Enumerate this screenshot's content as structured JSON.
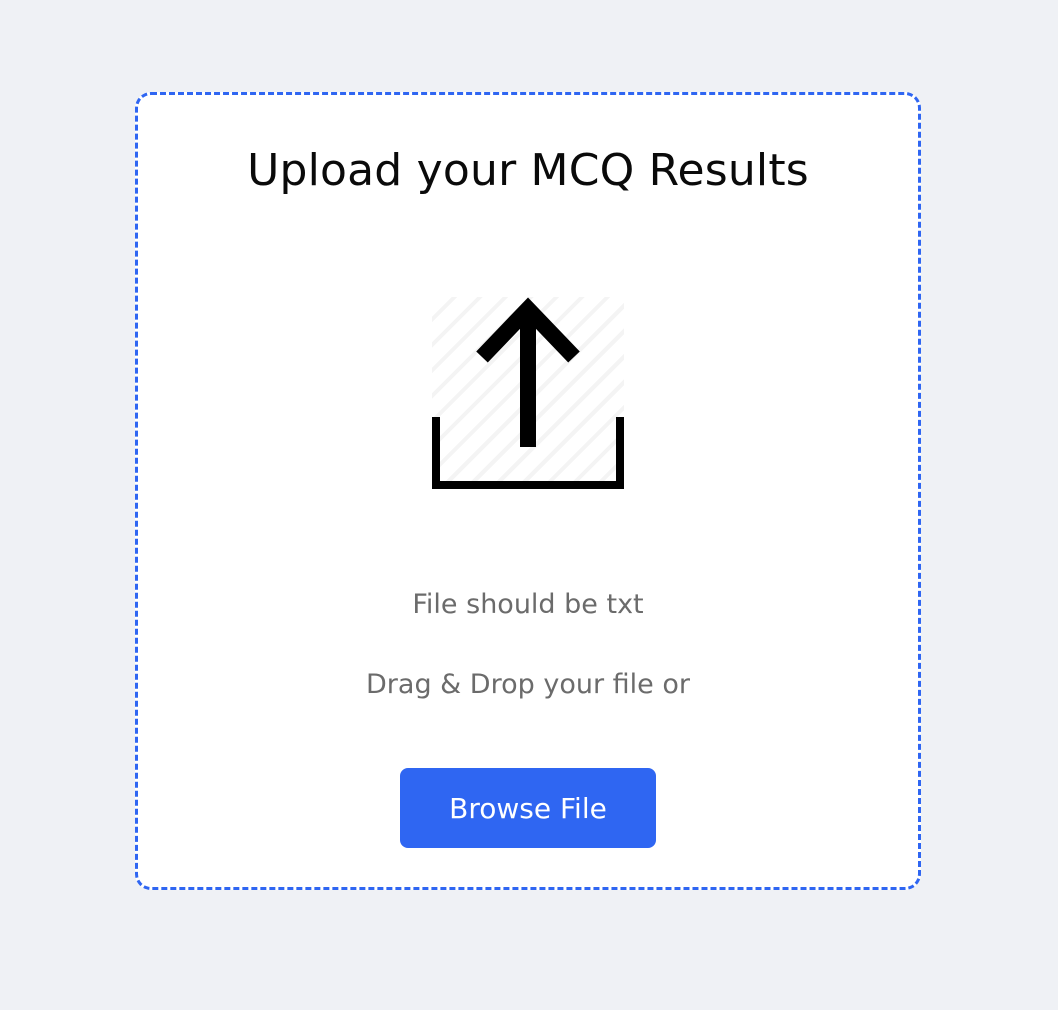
{
  "upload": {
    "title": "Upload your MCQ Results",
    "icon": "upload-icon",
    "format_hint": "File should be txt",
    "drag_hint": "Drag & Drop your file or",
    "browse_label": "Browse File"
  },
  "colors": {
    "background": "#eff1f5",
    "card": "#ffffff",
    "accent": "#2f66f2",
    "title_text": "#0a0a0a",
    "hint_text": "#6b6b6b",
    "button_text": "#ffffff"
  }
}
